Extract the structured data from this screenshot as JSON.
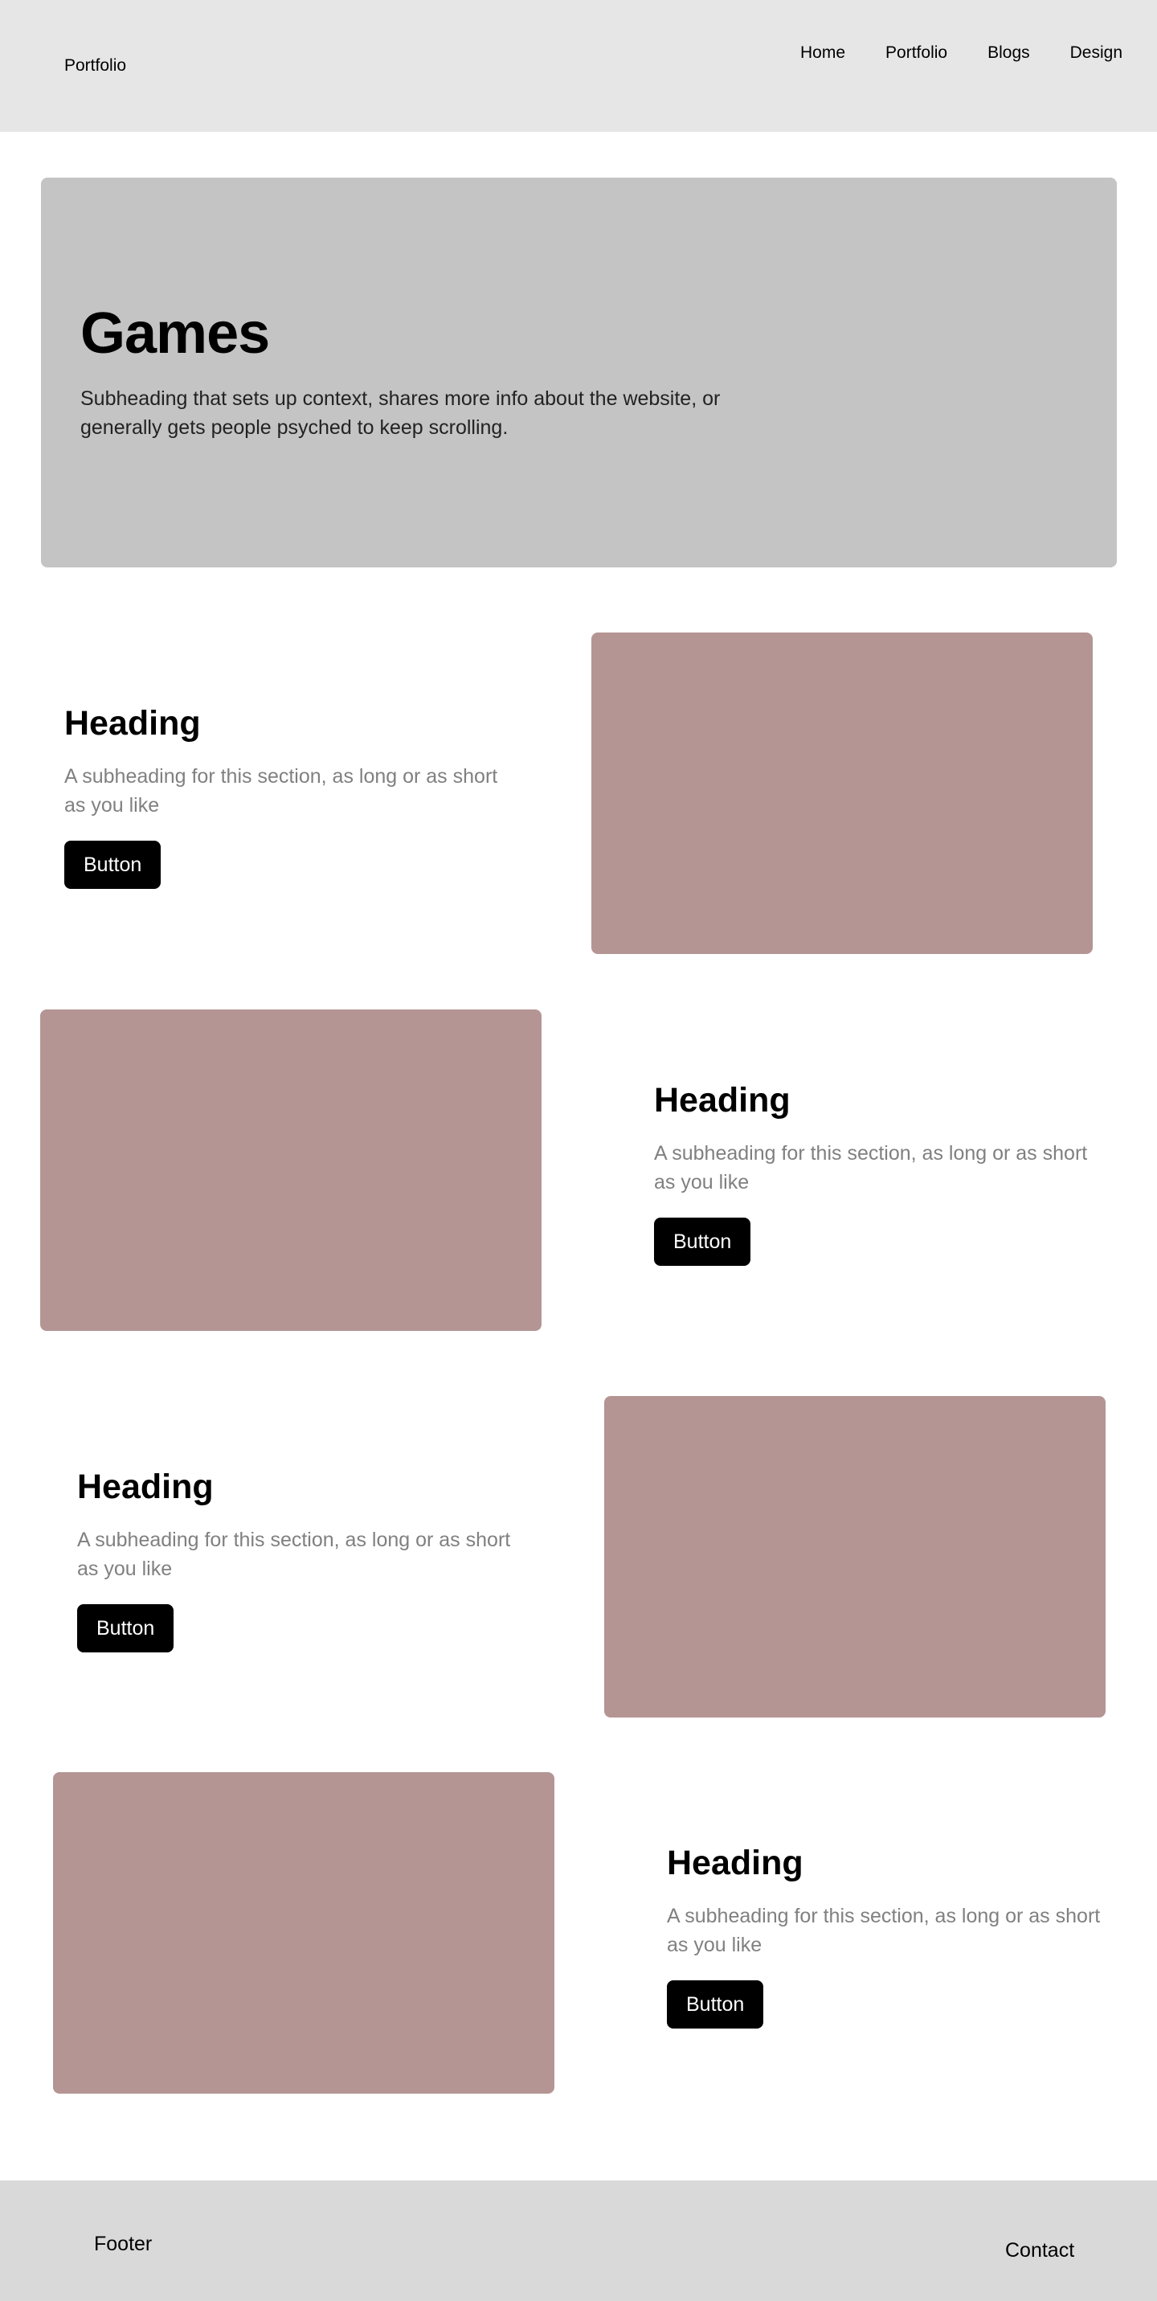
{
  "header": {
    "brand": "Portfolio",
    "nav": [
      {
        "label": "Home"
      },
      {
        "label": "Portfolio"
      },
      {
        "label": "Blogs"
      },
      {
        "label": "Design"
      }
    ]
  },
  "hero": {
    "title": "Games",
    "subtitle": "Subheading that sets up context, shares more info about the website, or generally gets people psyched to keep scrolling."
  },
  "sections": [
    {
      "heading": "Heading",
      "subheading": "A subheading for this section, as long or as short as you like",
      "button": "Button"
    },
    {
      "heading": "Heading",
      "subheading": "A subheading for this section, as long or as short as you like",
      "button": "Button"
    },
    {
      "heading": "Heading",
      "subheading": "A subheading for this section, as long or as short as you like",
      "button": "Button"
    },
    {
      "heading": "Heading",
      "subheading": "A subheading for this section, as long or as short as you like",
      "button": "Button"
    }
  ],
  "colors": {
    "header_bg": "#e6e6e6",
    "hero_bg": "#c4c4c4",
    "image_placeholder": "#b49594",
    "footer_bg": "#d9d9d9",
    "button_bg": "#000000",
    "subheading_text": "#808080"
  },
  "footer": {
    "label": "Footer",
    "contact": "Contact"
  }
}
